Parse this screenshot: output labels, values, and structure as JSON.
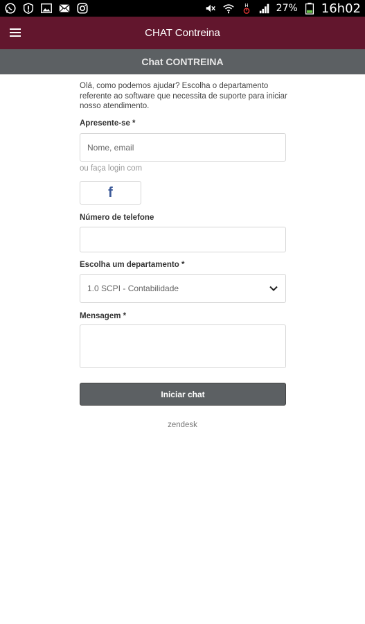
{
  "statusbar": {
    "left_icons": [
      "whatsapp-icon",
      "alert-icon",
      "image-icon",
      "mail-icon",
      "instagram-icon"
    ],
    "right_icons": [
      "mute-icon",
      "wifi-icon",
      "hd-icon",
      "signal-icon",
      "battery-icon"
    ],
    "hd_label": "H",
    "battery": "27%",
    "time": "16h02"
  },
  "appbar": {
    "title": "CHAT Contreina",
    "color": "#62162d"
  },
  "chat_header": {
    "title": "Chat CONTREINA",
    "color": "#5c6063"
  },
  "form": {
    "intro": "Olá, como podemos ajudar? Escolha o departamento referente ao software que necessita de suporte para iniciar nosso atendimento.",
    "name": {
      "label": "Apresente-se *",
      "placeholder": "Nome, email"
    },
    "social": {
      "label": "ou faça login com",
      "facebook_glyph": "f"
    },
    "phone": {
      "label": "Número de telefone",
      "value": ""
    },
    "department": {
      "label": "Escolha um departamento *",
      "selected": "1.0 SCPI - Contabilidade"
    },
    "message": {
      "label": "Mensagem *",
      "value": ""
    },
    "submit_label": "Iniciar chat"
  },
  "footer": {
    "brand": "zendesk"
  }
}
